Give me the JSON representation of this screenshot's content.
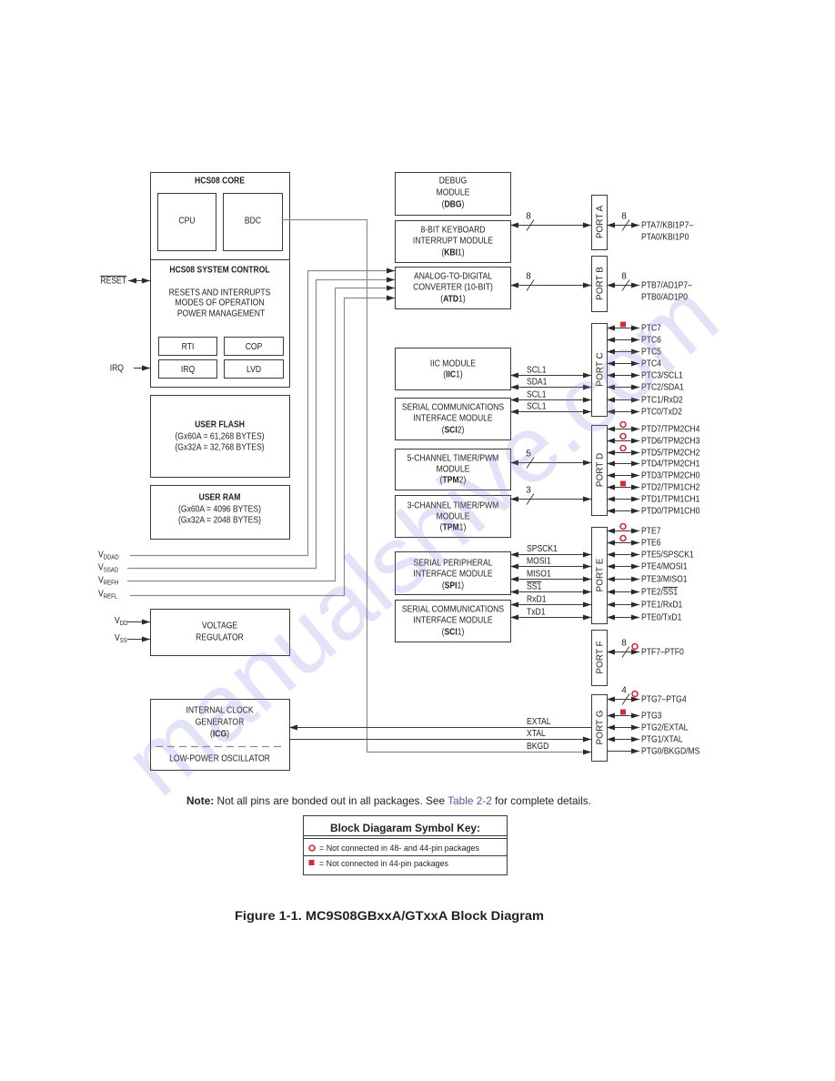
{
  "document": {
    "watermark": "manualshive.com"
  },
  "core": {
    "title": "HCS08 CORE",
    "cpu": "CPU",
    "bdc": "BDC"
  },
  "system_control": {
    "title": "HCS08 SYSTEM CONTROL",
    "functions": [
      "RESETS AND INTERRUPTS",
      "MODES OF OPERATION",
      "POWER MANAGEMENT"
    ],
    "rti": "RTI",
    "cop": "COP",
    "irq": "IRQ",
    "lvd": "LVD"
  },
  "user_flash": {
    "title": "USER FLASH",
    "sizes": [
      "(Gx60A = 61,268 BYTES)",
      "(Gx32A = 32,768 BYTES)"
    ]
  },
  "user_ram": {
    "title": "USER RAM",
    "sizes": [
      "(Gx60A = 4096 BYTES)",
      "(Gx32A = 2048 BYTES)"
    ]
  },
  "voltage_regulator": {
    "lines": [
      "VOLTAGE",
      "REGULATOR"
    ]
  },
  "icg": {
    "lines": [
      "INTERNAL CLOCK",
      "GENERATOR"
    ],
    "abbr": {
      "open": "(",
      "bold": "ICG",
      "close": ")"
    },
    "oscillator": "LOW-POWER OSCILLATOR"
  },
  "external_pins": {
    "reset": "RESET",
    "irq": "IRQ",
    "vddad": {
      "v": "V",
      "sub": "DDAD"
    },
    "vssad": {
      "v": "V",
      "sub": "SSAD"
    },
    "vrefh": {
      "v": "V",
      "sub": "REFH"
    },
    "vrefl": {
      "v": "V",
      "sub": "REFL"
    },
    "vdd": {
      "v": "V",
      "sub": "DD"
    },
    "vss": {
      "v": "V",
      "sub": "SS"
    }
  },
  "modules": {
    "dbg": {
      "lines": [
        "DEBUG",
        "MODULE"
      ],
      "abbr": {
        "open": "(",
        "bold": "DBG",
        "close": ")"
      }
    },
    "kbi": {
      "lines": [
        "8-BIT KEYBOARD",
        "INTERRUPT MODULE"
      ],
      "abbr": {
        "open": "(",
        "bold": "KBI",
        "close": "1)"
      }
    },
    "atd": {
      "lines": [
        "ANALOG-TO-DIGITAL",
        "CONVERTER (10-BIT)"
      ],
      "abbr": {
        "open": "(",
        "bold": "ATD",
        "close": "1)"
      }
    },
    "iic": {
      "lines": [
        "IIC MODULE"
      ],
      "abbr": {
        "open": "(",
        "bold": "IIC",
        "close": "1)"
      }
    },
    "sci2": {
      "lines": [
        "SERIAL COMMUNICATIONS",
        "INTERFACE MODULE"
      ],
      "abbr": {
        "open": "(",
        "bold": "SCI",
        "close": "2)"
      }
    },
    "tpm2": {
      "lines": [
        "5-CHANNEL TIMER/PWM",
        "MODULE"
      ],
      "abbr": {
        "open": "(",
        "bold": "TPM",
        "close": "2)"
      }
    },
    "tpm1": {
      "lines": [
        "3-CHANNEL TIMER/PWM",
        "MODULE"
      ],
      "abbr": {
        "open": "(",
        "bold": "TPM",
        "close": "1)"
      }
    },
    "spi1": {
      "lines": [
        "SERIAL PERIPHERAL",
        "INTERFACE MODULE"
      ],
      "abbr": {
        "open": "(",
        "bold": "SPI",
        "close": "1)"
      }
    },
    "sci1": {
      "lines": [
        "SERIAL COMMUNICATIONS",
        "INTERFACE MODULE"
      ],
      "abbr": {
        "open": "(",
        "bold": "SCI",
        "close": "1)"
      }
    }
  },
  "bus_widths": {
    "kbi": "8",
    "atd": "8",
    "tpm2": "5",
    "tpm1": "3"
  },
  "signals": {
    "iic": [
      "SCL1",
      "SDA1"
    ],
    "sci2": [
      "SCL1",
      "SCL1"
    ],
    "spi1": [
      "SPSCK1",
      "MOSI1",
      "MISO1",
      "SS1"
    ],
    "sci1": [
      "RxD1",
      "TxD1"
    ],
    "clock": [
      "EXTAL",
      "XTAL",
      "BKGD"
    ]
  },
  "ports": [
    {
      "id": "a",
      "name": "PORT A",
      "pins": [
        {
          "label": "PTA7/KBI1P7–",
          "label2": "PTA0/KBI1P0",
          "width": "8",
          "direction": "bidirectional"
        }
      ]
    },
    {
      "id": "b",
      "name": "PORT B",
      "pins": [
        {
          "label": "PTB7/AD1P7–",
          "label2": "PTB0/AD1P0",
          "width": "8",
          "direction": "bidirectional"
        }
      ]
    },
    {
      "id": "c",
      "name": "PORT C",
      "pins": [
        {
          "label": "PTC7",
          "marker": "square",
          "direction": "bidirectional"
        },
        {
          "label": "PTC6",
          "direction": "bidirectional"
        },
        {
          "label": "PTC5",
          "direction": "bidirectional"
        },
        {
          "label": "PTC4",
          "direction": "bidirectional"
        },
        {
          "label": "PTC3/SCL1",
          "direction": "bidirectional"
        },
        {
          "label": "PTC2/SDA1",
          "direction": "bidirectional"
        },
        {
          "label": "PTC1/RxD2",
          "direction": "bidirectional"
        },
        {
          "label": "PTC0/TxD2",
          "direction": "bidirectional"
        }
      ]
    },
    {
      "id": "d",
      "name": "PORT D",
      "pins": [
        {
          "label": "PTD7/TPM2CH4",
          "marker": "circle",
          "direction": "bidirectional"
        },
        {
          "label": "PTD6/TPM2CH3",
          "marker": "circle",
          "direction": "bidirectional"
        },
        {
          "label": "PTD5/TPM2CH2",
          "marker": "circle",
          "direction": "bidirectional"
        },
        {
          "label": "PTD4/TPM2CH1",
          "direction": "bidirectional"
        },
        {
          "label": "PTD3/TPM2CH0",
          "direction": "bidirectional"
        },
        {
          "label": "PTD2/TPM1CH2",
          "marker": "square",
          "direction": "bidirectional"
        },
        {
          "label": "PTD1/TPM1CH1",
          "direction": "bidirectional"
        },
        {
          "label": "PTD0/TPM1CH0",
          "direction": "bidirectional"
        }
      ]
    },
    {
      "id": "e",
      "name": "PORT E",
      "pins": [
        {
          "label": "PTE7",
          "marker": "circle",
          "direction": "bidirectional"
        },
        {
          "label": "PTE6",
          "marker": "circle",
          "direction": "bidirectional"
        },
        {
          "label": "PTE5/SPSCK1",
          "direction": "bidirectional"
        },
        {
          "label": "PTE4/MOSI1",
          "direction": "bidirectional"
        },
        {
          "label": "PTE3/MISO1",
          "direction": "bidirectional"
        },
        {
          "label": "PTE2/",
          "overline": "SS1",
          "direction": "bidirectional"
        },
        {
          "label": "PTE1/RxD1",
          "direction": "bidirectional"
        },
        {
          "label": "PTE0/TxD1",
          "direction": "bidirectional"
        }
      ]
    },
    {
      "id": "f",
      "name": "PORT F",
      "pins": [
        {
          "label": "PTF7–PTF0",
          "width": "8",
          "marker": "circle",
          "direction": "bidirectional"
        }
      ]
    },
    {
      "id": "g",
      "name": "PORT G",
      "pins": [
        {
          "label": "PTG7–PTG4",
          "width": "4",
          "marker": "circle",
          "direction": "bidirectional"
        },
        {
          "label": "PTG3",
          "marker": "square",
          "direction": "bidirectional"
        },
        {
          "label": "PTG2/EXTAL",
          "direction": "bidirectional"
        },
        {
          "label": "PTG1/XTAL",
          "direction": "bidirectional"
        },
        {
          "label": "PTG0/BKGD/MS",
          "direction": "output"
        }
      ]
    }
  ],
  "note": {
    "label": "Note:",
    "text_before": " Not all pins are bonded out in all packages. See ",
    "link": "Table 2-2",
    "text_after": " for complete details."
  },
  "symbol_key": {
    "title": "Block Diagaram Symbol Key:",
    "items": [
      {
        "marker": "circle",
        "text": "= Not connected in 48- and 44-pin packages"
      },
      {
        "marker": "square",
        "text": "= Not connected in 44-pin packages"
      }
    ]
  },
  "caption": "Figure 1-1. MC9S08GBxxA/GTxxA Block Diagram",
  "colors": {
    "line": "#3a3a3a",
    "secondary_line": "#8a8a8a",
    "not_connected_marker": "#d42a3c",
    "link": "#4d5aa6",
    "watermark": "#8080e6"
  }
}
